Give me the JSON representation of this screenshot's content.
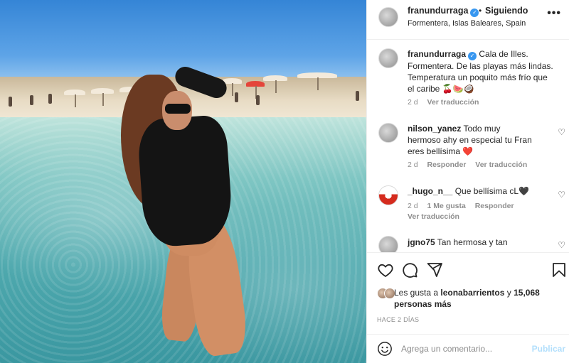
{
  "post": {
    "username": "franundurraga",
    "follow_status": "Siguiendo",
    "separator": "•",
    "location": "Formentera, Islas Baleares, Spain",
    "more_label": "•••"
  },
  "comments": [
    {
      "username": "franundurraga",
      "text": "Cala de Illes. Formentera. De las playas más lindas. Temperatura un poquito más frío que el caribe 🍒🍉🥥",
      "time": "2 d",
      "links": [
        "Ver traducción"
      ]
    },
    {
      "username": "nilson_yanez",
      "text": "Todo muy hermoso ahy en especial tu Fran eres bellísima ❤️",
      "time": "2 d",
      "links": [
        "Responder",
        "Ver traducción"
      ]
    },
    {
      "username": "_hugo_n__",
      "text": "Que bellísima cL🖤",
      "time": "2 d",
      "links": [
        "1 Me gusta",
        "Responder"
      ],
      "extra_link": "Ver traducción"
    },
    {
      "username": "jgno75",
      "text": "Tan hermosa y tan",
      "time": "",
      "links": []
    }
  ],
  "likes": {
    "prefix": "Les gusta a",
    "user": "leonabarrientos",
    "conj": "y",
    "count": "15,068 personas más"
  },
  "time_ago": "HACE 2 DÍAS",
  "comment_box": {
    "placeholder": "Agrega un comentario...",
    "publish_label": "Publicar"
  },
  "colors": {
    "verified": "#3897f0",
    "publish_disabled": "#b2dffc",
    "muted": "#8e8e8e"
  },
  "icons": [
    "heart-icon",
    "comment-icon",
    "share-icon",
    "bookmark-icon",
    "emoji-icon",
    "verified-icon"
  ]
}
